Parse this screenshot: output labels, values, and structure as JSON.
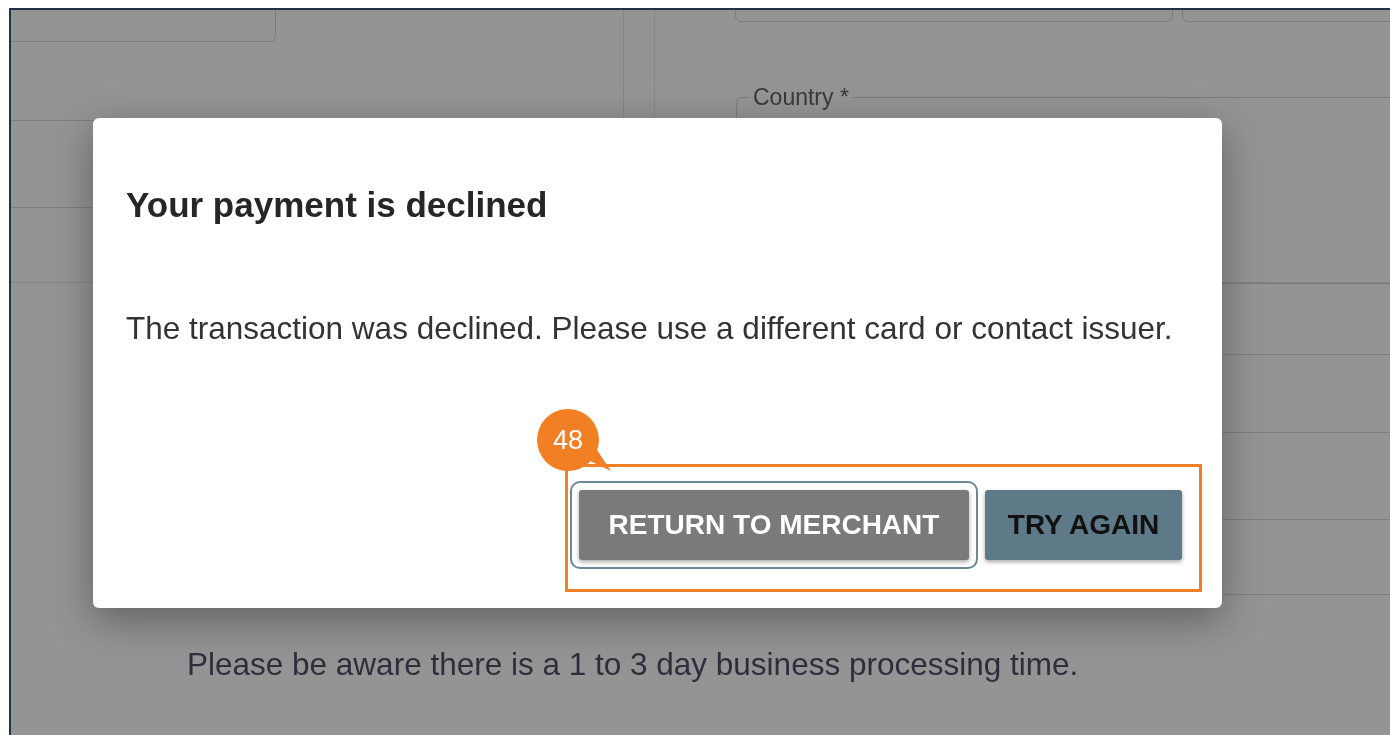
{
  "background_form": {
    "country_field": {
      "label": "Country *"
    },
    "notice": "Please be aware there is a 1 to 3 day business processing time."
  },
  "dialog": {
    "title": "Your payment is declined",
    "message": "The transaction was declined. Please use a different card or contact issuer.",
    "buttons": [
      {
        "label": "RETURN TO MERCHANT",
        "kind": "secondary",
        "focused": true
      },
      {
        "label": "TRY AGAIN",
        "kind": "primary",
        "focused": false
      }
    ]
  },
  "annotation": {
    "number": "48"
  }
}
